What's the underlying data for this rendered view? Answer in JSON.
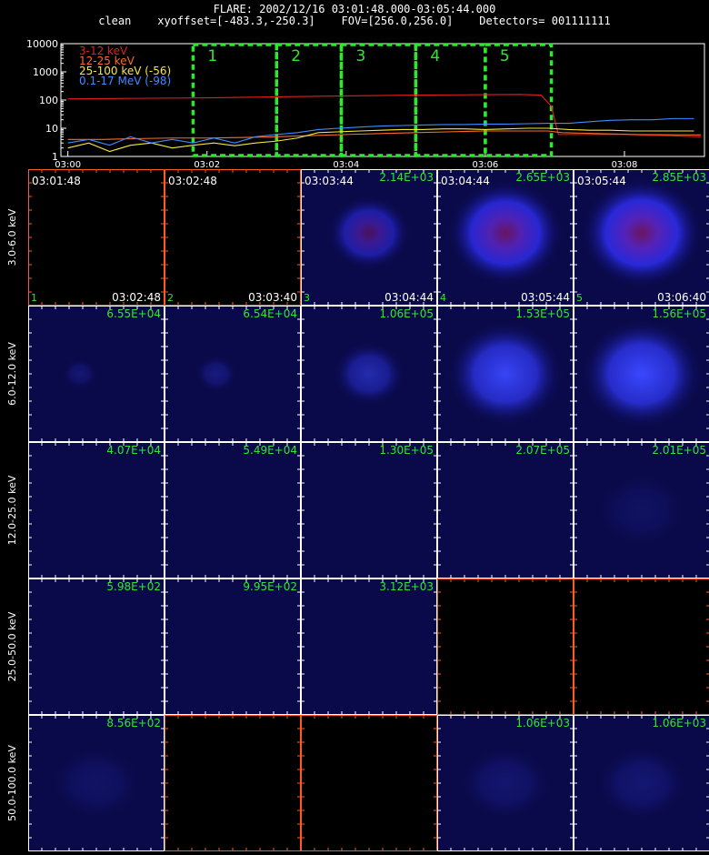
{
  "header": {
    "line1": "FLARE: 2002/12/16 03:01:48.000-03:05:44.000",
    "line2": "clean    xyoffset=[-483.3,-250.3]    FOV=[256.0,256.0]    Detectors= 001111111"
  },
  "chart_data": [
    {
      "type": "line",
      "yscale": "log",
      "ylim": [
        1,
        10000
      ],
      "yticks": [
        "10000",
        "1000",
        "100",
        "10",
        "1"
      ],
      "xticks": [
        "03:00",
        "03:02",
        "03:04",
        "03:06",
        "03:08"
      ],
      "xlim_minutes": [
        -0.1,
        9.15
      ],
      "series": [
        {
          "name": "3-12 keV",
          "color": "#e0201e",
          "x": [
            0,
            1,
            2,
            3,
            4,
            5,
            6,
            6.5,
            6.8,
            6.95,
            7.05,
            7.3,
            8,
            8.6,
            9.1
          ],
          "y": [
            110,
            115,
            120,
            130,
            140,
            150,
            155,
            158,
            150,
            60,
            6,
            6,
            6,
            5.5,
            5
          ]
        },
        {
          "name": "12-25 keV",
          "color": "#ff6a2a",
          "x": [
            0,
            0.5,
            1,
            1.5,
            2,
            2.5,
            3,
            3.5,
            4,
            4.5,
            5,
            5.5,
            6,
            6.5,
            6.9,
            7.1,
            7.6,
            8.2,
            9.1
          ],
          "y": [
            4,
            4,
            4.3,
            4.5,
            4.5,
            4.7,
            5,
            5.5,
            6,
            6.5,
            7,
            7.5,
            8,
            8,
            8,
            7,
            6.5,
            6,
            5.8
          ]
        },
        {
          "name": "25-100 keV (-56)",
          "color": "#f5ea3a",
          "x": [
            0,
            0.3,
            0.6,
            0.9,
            1.2,
            1.5,
            1.8,
            2.1,
            2.4,
            2.7,
            3.0,
            3.3,
            3.6,
            3.9,
            4.2,
            4.5,
            4.8,
            5.1,
            5.4,
            5.7,
            6.0,
            6.3,
            6.6,
            6.9,
            7.2,
            7.5,
            7.8,
            8.1,
            8.4,
            8.7,
            9.0
          ],
          "y": [
            2,
            3,
            1.5,
            2.5,
            3,
            2,
            2.5,
            3,
            2.4,
            3,
            3.5,
            4.5,
            7,
            7.5,
            8,
            8.5,
            9,
            9,
            9.5,
            9.5,
            9,
            9.5,
            10,
            10,
            9,
            8.5,
            8.5,
            8,
            8,
            8,
            8
          ]
        },
        {
          "name": "0.1-17 MeV (-98)",
          "color": "#3f8cff",
          "x": [
            0,
            0.3,
            0.6,
            0.9,
            1.2,
            1.5,
            1.8,
            2.1,
            2.4,
            2.7,
            3.0,
            3.3,
            3.6,
            3.9,
            4.2,
            4.5,
            4.8,
            5.1,
            5.4,
            5.7,
            6.0,
            6.3,
            6.6,
            6.9,
            7.2,
            7.5,
            7.8,
            8.1,
            8.4,
            8.7,
            9.0
          ],
          "y": [
            3,
            4,
            2.5,
            5,
            3,
            4,
            3,
            4.5,
            3,
            5,
            6,
            7,
            9,
            10,
            11,
            12,
            12.5,
            13,
            13.5,
            13.5,
            14,
            14,
            14.5,
            15,
            15,
            17,
            19,
            20,
            20,
            22,
            22
          ]
        }
      ],
      "intervals": [
        {
          "label": "1",
          "start": 1.8,
          "end": 3.0
        },
        {
          "label": "2",
          "start": 3.0,
          "end": 3.93
        },
        {
          "label": "3",
          "start": 3.93,
          "end": 5.0
        },
        {
          "label": "4",
          "start": 5.0,
          "end": 6.0
        },
        {
          "label": "5",
          "start": 6.0,
          "end": 6.95
        }
      ]
    },
    {
      "type": "heatmap",
      "row_labels": [
        "3.0-6.0 keV",
        "6.0-12.0 keV",
        "12.0-25.0 keV",
        "25.0-50.0 keV",
        "50.0-100.0 keV"
      ],
      "column_numbers": [
        "1",
        "2",
        "3",
        "4",
        "5"
      ],
      "start_times": [
        "03:01:48",
        "03:02:48",
        "03:03:44",
        "03:04:44",
        "03:05:44"
      ],
      "end_times": [
        "03:02:48",
        "03:03:40",
        "03:04:44",
        "03:05:44",
        "03:06:40"
      ],
      "max_values": [
        [
          "",
          "",
          "2.14E+03",
          "2.65E+03",
          "2.85E+03"
        ],
        [
          "6.55E+04",
          "6.54E+04",
          "1.06E+05",
          "1.53E+05",
          "1.56E+05"
        ],
        [
          "4.07E+04",
          "5.49E+04",
          "1.30E+05",
          "2.07E+05",
          "2.01E+05"
        ],
        [
          "5.98E+02",
          "9.95E+02",
          "3.12E+03",
          "",
          ""
        ],
        [
          "8.56E+02",
          "",
          "",
          "1.06E+03",
          "1.06E+03"
        ]
      ],
      "image_intensity": [
        [
          0,
          0,
          0.55,
          0.85,
          0.9
        ],
        [
          0.12,
          0.18,
          0.45,
          0.85,
          0.9
        ],
        [
          0,
          0,
          0,
          0,
          0.03
        ],
        [
          0,
          0,
          0,
          0,
          0
        ],
        [
          0.05,
          0,
          0,
          0.1,
          0.12
        ]
      ],
      "empty_cells": [
        [
          0,
          0
        ],
        [
          0,
          1
        ],
        [
          3,
          3
        ],
        [
          3,
          4
        ],
        [
          4,
          1
        ],
        [
          4,
          2
        ]
      ]
    }
  ]
}
